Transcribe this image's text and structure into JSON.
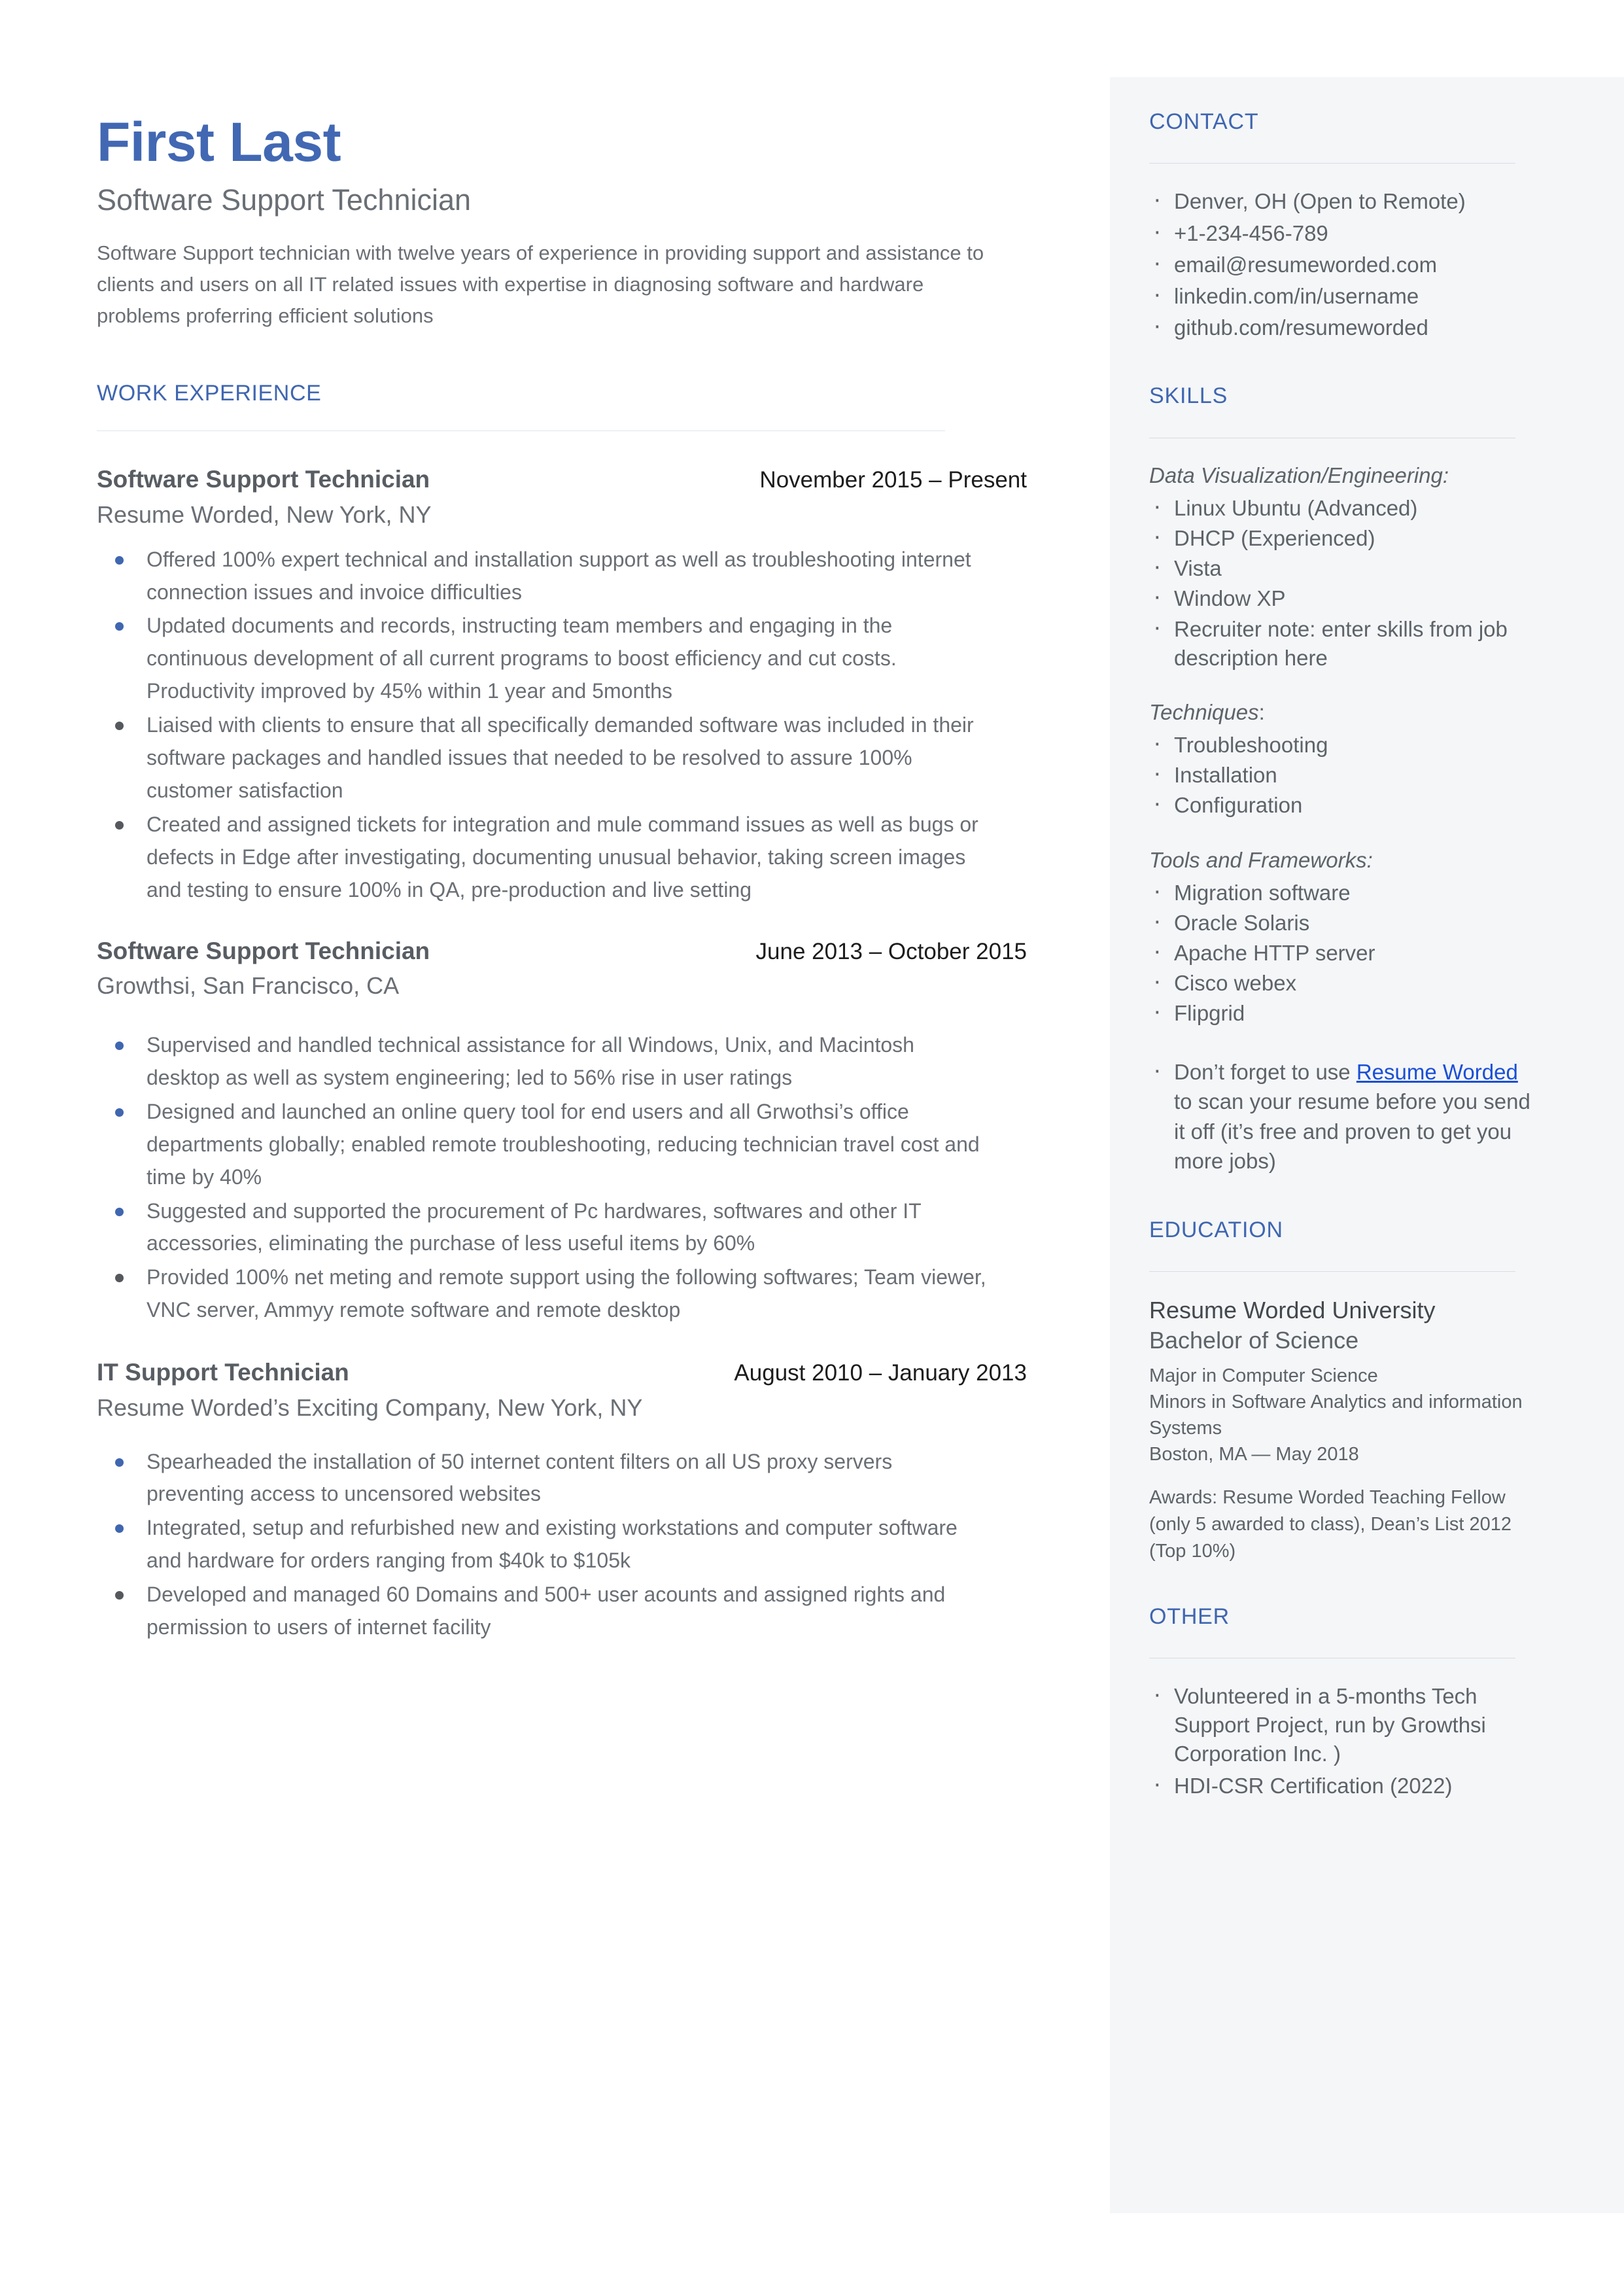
{
  "theme": {
    "accent_blue": "#3f66b0",
    "name_blue": "#4268b3",
    "link_blue": "#1a4fd6",
    "body_gray": "#6a6f75",
    "sidebar_bg": "#f4f6f8"
  },
  "header": {
    "name": "First Last",
    "role": "Software Support Technician",
    "summary": "Software Support technician with twelve years of experience in providing support and assistance to clients and users on all IT related issues with expertise in diagnosing software and hardware problems proferring efficient solutions"
  },
  "work_experience": {
    "heading": "WORK EXPERIENCE",
    "jobs": [
      {
        "title": "Software Support Technician",
        "dates": "November 2015 – Present",
        "company": "Resume Worded, New York, NY",
        "bullets": [
          "Offered 100% expert technical and installation support as well as troubleshooting internet connection issues and invoice difficulties",
          "Updated documents and records, instructing team members and engaging in the continuous development of all current programs to boost efficiency and cut costs. Productivity improved by 45% within 1 year and 5months",
          "Liaised with clients to ensure that all specifically demanded software was included in their software packages and handled issues that needed to be resolved to assure 100% customer satisfaction",
          "Created and assigned tickets for integration and mule command issues as well as bugs or defects in Edge after investigating, documenting unusual behavior, taking screen images and testing to ensure 100% in QA, pre-production and live setting"
        ]
      },
      {
        "title": "Software Support Technician",
        "dates": "June 2013 – October 2015",
        "company": "Growthsi, San Francisco, CA",
        "bullets": [
          "Supervised and handled technical assistance for all Windows, Unix, and Macintosh desktop as well as system engineering; led to 56% rise in user ratings",
          "Designed and launched an online query tool for end users and all Grwothsi’s office departments globally; enabled remote troubleshooting, reducing technician travel cost and time by 40%",
          "Suggested and supported the procurement of Pc hardwares, softwares and other IT accessories, eliminating the purchase of less useful items by 60%",
          "Provided 100% net meting and remote support using the following softwares; Team viewer, VNC server, Ammyy remote software and remote desktop"
        ]
      },
      {
        "title": "IT Support Technician",
        "dates": "August 2010 – January 2013",
        "company": "Resume Worded’s Exciting Company, New York, NY",
        "bullets": [
          "Spearheaded the installation of 50 internet content filters on all US proxy servers preventing access to uncensored websites",
          "Integrated, setup and refurbished new and existing workstations and computer software and hardware for orders ranging from $40k to $105k",
          "Developed and managed 60 Domains and 500+ user acounts and assigned rights and permission to users of internet facility"
        ]
      }
    ]
  },
  "contact": {
    "heading": "CONTACT",
    "items": [
      "Denver, OH (Open to Remote)",
      "+1-234-456-789",
      "email@resumeworded.com",
      "linkedin.com/in/username",
      "github.com/resumeworded"
    ]
  },
  "skills": {
    "heading": "SKILLS",
    "groups": [
      {
        "label": "Data Visualization/Engineering:",
        "items": [
          "Linux Ubuntu (Advanced)",
          "DHCP (Experienced)",
          "Vista",
          "Window XP",
          "Recruiter note: enter skills from job description here"
        ]
      },
      {
        "label": "Techniques",
        "label_suffix": ":",
        "items": [
          "Troubleshooting",
          "Installation",
          "Configuration"
        ]
      },
      {
        "label": "Tools and Frameworks:",
        "items": [
          "Migration software",
          "Oracle Solaris",
          "Apache HTTP server",
          "Cisco webex",
          "Flipgrid"
        ]
      }
    ],
    "promo": {
      "prefix": "Don’t forget to use ",
      "link_text": "Resume Worded",
      "suffix": " to scan your resume before you send it off (it’s free and proven to get you more jobs)"
    }
  },
  "education": {
    "heading": "EDUCATION",
    "school": "Resume Worded University",
    "degree": "Bachelor of Science",
    "major": "Major in Computer Science",
    "minors": "Minors in Software Analytics and information Systems",
    "location_date": "Boston, MA — May 2018",
    "awards": "Awards: Resume Worded Teaching Fellow (only 5 awarded to class), Dean’s List 2012 (Top 10%)"
  },
  "other": {
    "heading": "OTHER",
    "items": [
      "Volunteered in a 5-months Tech Support Project, run by Growthsi Corporation Inc. )",
      "HDI-CSR Certification (2022)"
    ]
  }
}
